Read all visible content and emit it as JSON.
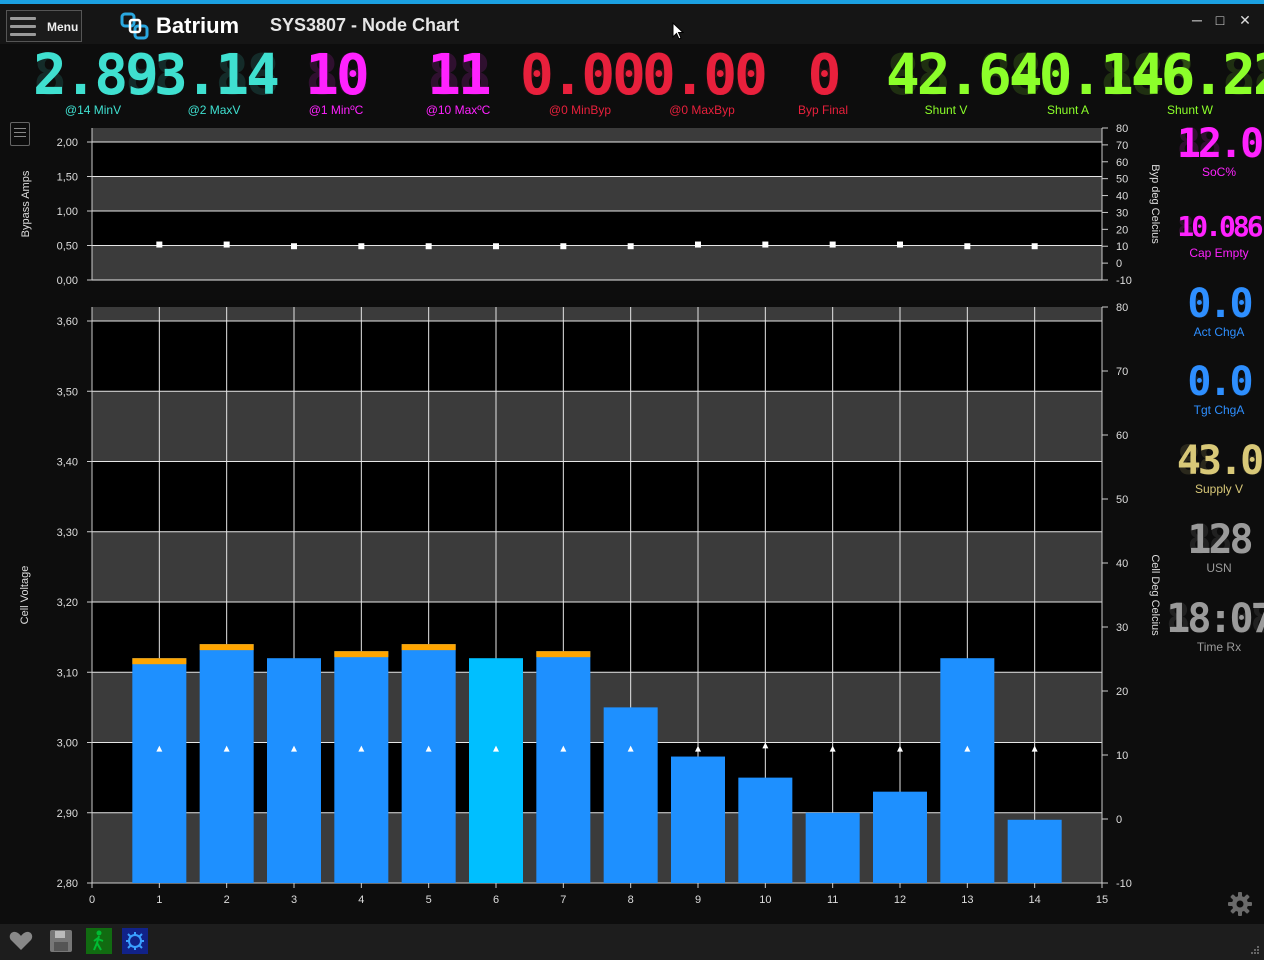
{
  "window": {
    "menu_label": "Menu",
    "brand": "Batrium",
    "title": "SYS3807 - Node Chart",
    "minimize_icon": "minimize-icon",
    "maximize_icon": "maximize-icon",
    "close_icon": "close-icon"
  },
  "top_metrics": [
    {
      "value": "2.89",
      "ghost": "8.88",
      "label": "@14 MinV",
      "color": "#3fe0d0"
    },
    {
      "value": "3.14",
      "ghost": "8.88",
      "label": "@2 MaxV",
      "color": "#3fe0d0"
    },
    {
      "value": "10",
      "ghost": "88",
      "label": "@1 MinºC",
      "color": "#ff22ff"
    },
    {
      "value": "11",
      "ghost": "88",
      "label": "@10 MaxºC",
      "color": "#ff22ff"
    },
    {
      "value": "0.00",
      "ghost": "8.88",
      "label": "@0 MinByp",
      "color": "#e8203c"
    },
    {
      "value": "0.00",
      "ghost": "8.88",
      "label": "@0 MaxByp",
      "color": "#e8203c"
    },
    {
      "value": "0",
      "ghost": "8",
      "label": "Byp Final",
      "color": "#e8203c"
    },
    {
      "value": "42.64",
      "ghost": "88.88",
      "label": "Shunt V",
      "color": "#8cff2a"
    },
    {
      "value": "-0.146",
      "ghost": "-8.888",
      "label": "Shunt A",
      "color": "#8cff2a"
    },
    {
      "value": "-6.22",
      "ghost": "-8.88",
      "label": "Shunt W",
      "color": "#8cff2a"
    }
  ],
  "side_metrics": [
    {
      "value": "12.0",
      "ghost": "88.8",
      "label": "SoC%",
      "color": "#ff22ff"
    },
    {
      "value": "10.086",
      "ghost": "88.888",
      "label": "Cap Empty",
      "color": "#ff22ff"
    },
    {
      "value": "0.0",
      "ghost": "8.8",
      "label": "Act ChgA",
      "color": "#2e8fff"
    },
    {
      "value": "0.0",
      "ghost": "8.8",
      "label": "Tgt ChgA",
      "color": "#2e8fff"
    },
    {
      "value": "43.0",
      "ghost": "88.8",
      "label": "Supply V",
      "color": "#d8c878"
    },
    {
      "value": "128",
      "ghost": "888",
      "label": "USN",
      "color": "#9a9a9a"
    },
    {
      "value": "18:07",
      "ghost": "88:88",
      "label": "Time Rx",
      "color": "#9a9a9a"
    }
  ],
  "chart_data": [
    {
      "type": "scatter",
      "ylabel": "Bypass Amps",
      "y2label": "Byp deg Celcius",
      "ylim": [
        0,
        2.0
      ],
      "y2lim": [
        -10,
        80
      ],
      "yticks": [
        "0,00",
        "0,50",
        "1,00",
        "1,50",
        "2,00"
      ],
      "y2ticks": [
        "-10",
        "0",
        "10",
        "20",
        "30",
        "40",
        "50",
        "60",
        "70",
        "80"
      ],
      "series": [
        {
          "x": [
            1,
            2,
            3,
            4,
            5,
            6,
            7,
            8,
            9,
            10,
            11,
            12,
            13,
            14
          ],
          "values": [
            11,
            11,
            10,
            10,
            10,
            10,
            10,
            10,
            11,
            11,
            11,
            11,
            10,
            10
          ]
        }
      ]
    },
    {
      "type": "bar",
      "ylabel": "Cell Voltage",
      "y2label": "Cell Deg Celcius",
      "xlim": [
        0,
        15
      ],
      "ylim": [
        2.8,
        3.62
      ],
      "y2lim": [
        -10,
        80
      ],
      "xticks": [
        "0",
        "1",
        "2",
        "3",
        "4",
        "5",
        "6",
        "7",
        "8",
        "9",
        "10",
        "11",
        "12",
        "13",
        "14",
        "15"
      ],
      "yticks": [
        "2,80",
        "2,90",
        "3,00",
        "3,10",
        "3,20",
        "3,30",
        "3,40",
        "3,50",
        "3,60"
      ],
      "y2ticks": [
        "-10",
        "0",
        "10",
        "20",
        "30",
        "40",
        "50",
        "60",
        "70",
        "80"
      ],
      "categories": [
        "1",
        "2",
        "3",
        "4",
        "5",
        "6",
        "7",
        "8",
        "9",
        "10",
        "11",
        "12",
        "13",
        "14"
      ],
      "values": [
        3.12,
        3.14,
        3.12,
        3.13,
        3.14,
        3.12,
        3.13,
        3.05,
        2.98,
        2.95,
        2.9,
        2.93,
        3.12,
        2.89
      ],
      "bypass_flag": [
        true,
        true,
        false,
        true,
        true,
        false,
        true,
        false,
        false,
        false,
        false,
        false,
        false,
        false
      ],
      "highlight": [
        false,
        false,
        false,
        false,
        false,
        true,
        false,
        false,
        false,
        false,
        false,
        false,
        false,
        false
      ],
      "temperature": [
        11,
        11,
        11,
        11,
        11,
        11,
        11,
        11,
        11,
        11.5,
        11,
        11,
        11,
        11
      ],
      "colors": {
        "bar": "#1e90ff",
        "highlight": "#00bfff",
        "bypass": "#ffa500",
        "temp_marker": "#ffffff"
      }
    }
  ],
  "status_icons": [
    "heart-icon",
    "save-icon",
    "walking-figure-icon",
    "bug-icon"
  ],
  "settings_icon": "gear-icon"
}
